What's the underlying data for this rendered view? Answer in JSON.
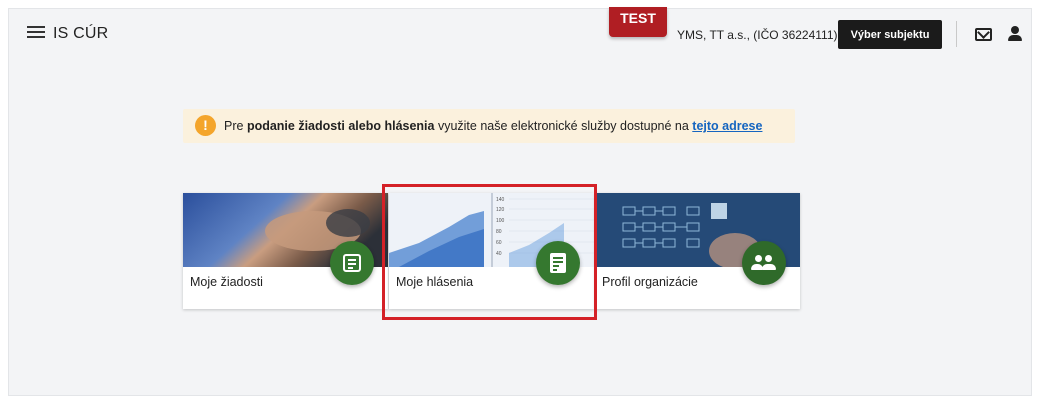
{
  "header": {
    "app_title": "IS CÚR",
    "env_badge": "TEST",
    "subject_name": "YMS, TT a.s., (IČO 36224111)",
    "select_subject_label": "Výber subjektu",
    "icons": [
      "menu-icon",
      "mail-icon",
      "user-icon"
    ]
  },
  "notice": {
    "prefix": "Pre ",
    "bold": "podanie žiadosti alebo hlásenia",
    "middle": " využite naše elektronické služby dostupné na ",
    "link": "tejto adrese",
    "icon": "info-icon",
    "color": "#fbf1dd"
  },
  "cards": [
    {
      "label": "Moje žiadosti",
      "icon": "document-icon"
    },
    {
      "label": "Moje hlásenia",
      "icon": "list-check-icon"
    },
    {
      "label": "Profil organizácie",
      "icon": "group-icon"
    }
  ],
  "chart_ticks": [
    "140",
    "120",
    "100",
    "80",
    "60",
    "40"
  ],
  "colors": {
    "accent_green": "#35782f",
    "badge_red": "#b01e23",
    "highlight_red": "#d42127",
    "link_blue": "#1565c0"
  }
}
